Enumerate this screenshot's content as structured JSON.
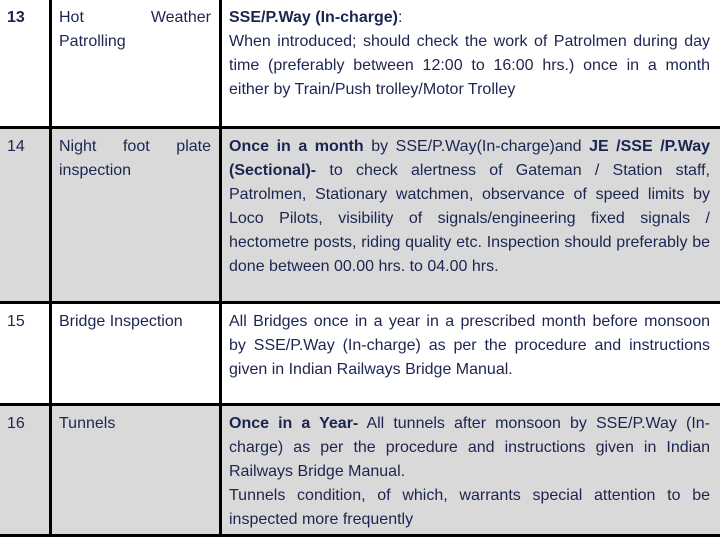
{
  "rows": [
    {
      "no": "13",
      "item": "Hot Weather Patrolling",
      "b1": "SSE/P.Way (In-charge)",
      "t1": ":",
      "t2": "When introduced; should check the work of Patrolmen during day time (preferably between 12:00 to 16:00 hrs.) once in a month either by Train/Push trolley/Motor Trolley"
    },
    {
      "no": "14",
      "item": "Night foot plate inspection",
      "b1": "Once in a month",
      "t1": " by SSE/P.Way(In-charge)and ",
      "b2": "JE /SSE /P.Way (Sectional)-",
      "t2": " to check alertness of Gateman / Station staff, Patrolmen, Stationary watchmen, observance of speed limits by Loco Pilots, visibility of signals/engineering fixed signals / hectometre posts, riding quality etc. Inspection should preferably be done between 00.00 hrs. to 04.00 hrs."
    },
    {
      "no": "15",
      "item": "Bridge Inspection",
      "t1": "All Bridges once in a year in a prescribed month before monsoon by SSE/P.Way (In-charge) as per the procedure and instructions given in Indian Railways Bridge Manual."
    },
    {
      "no": "16",
      "item": "Tunnels",
      "b1": "Once in a Year-",
      "t1": " All tunnels after monsoon by SSE/P.Way (In-charge) as per the procedure and instructions given in Indian Railways Bridge Manual.",
      "t2": "Tunnels condition, of which, warrants special attention to be inspected more frequently"
    }
  ]
}
